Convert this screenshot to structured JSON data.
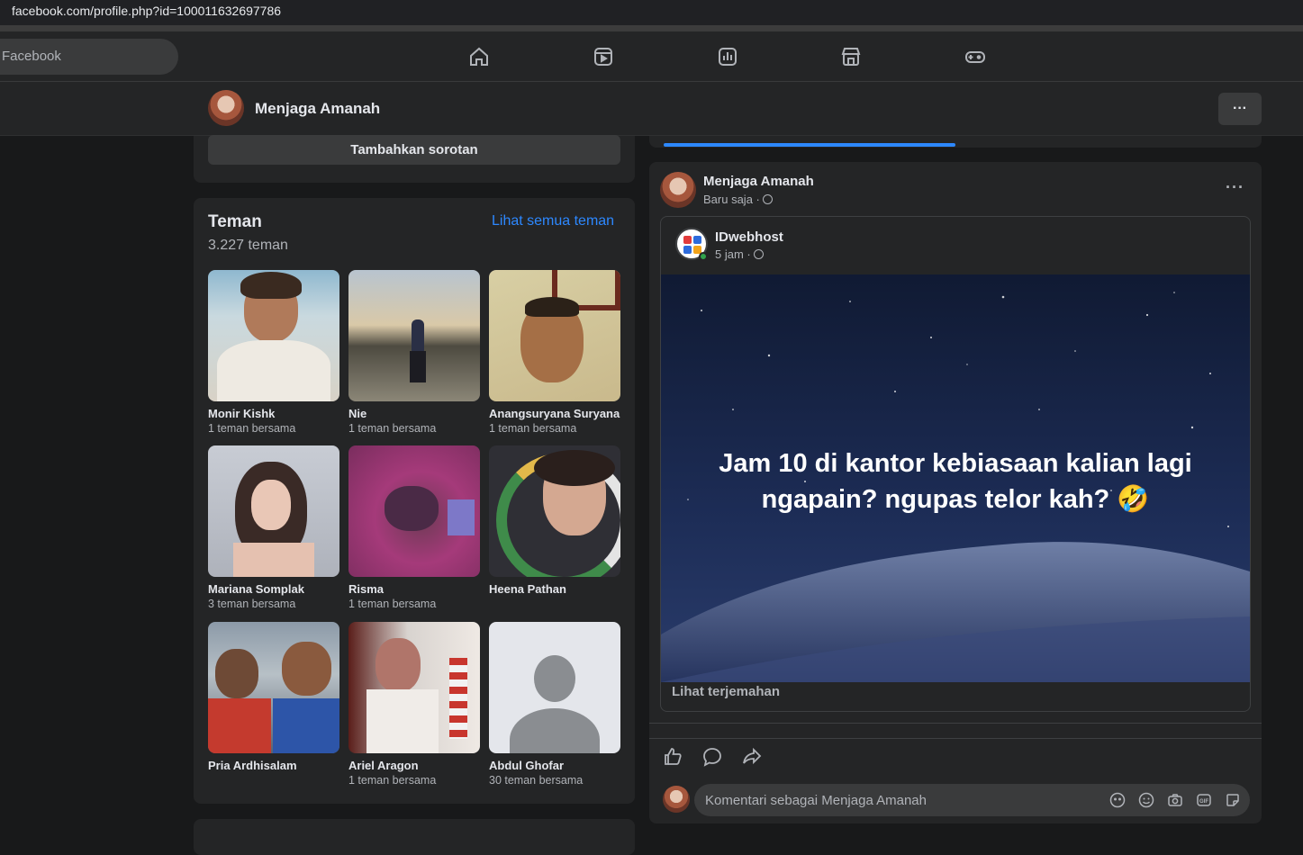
{
  "browser": {
    "url": "facebook.com/profile.php?id=100011632697786"
  },
  "topnav": {
    "search_placeholder": "Facebook",
    "icons": [
      "home-icon",
      "video-icon",
      "feed-chart-icon",
      "marketplace-icon",
      "gaming-icon"
    ]
  },
  "profile_bar": {
    "name": "Menjaga Amanah",
    "more_label": "···"
  },
  "highlights": {
    "add_label": "Tambahkan sorotan"
  },
  "friends": {
    "title": "Teman",
    "count": "3.227 teman",
    "see_all": "Lihat semua teman",
    "items": [
      {
        "name": "Monir Kishk",
        "mutual": "1 teman bersama"
      },
      {
        "name": "Nie",
        "mutual": "1 teman bersama"
      },
      {
        "name": "Anangsuryana Suryana",
        "mutual": "1 teman bersama"
      },
      {
        "name": "Mariana Somplak",
        "mutual": "3 teman bersama"
      },
      {
        "name": "Risma",
        "mutual": "1 teman bersama"
      },
      {
        "name": "Heena Pathan",
        "mutual": ""
      },
      {
        "name": "Pria Ardhisalam",
        "mutual": ""
      },
      {
        "name": "Ariel Aragon",
        "mutual": "1 teman bersama"
      },
      {
        "name": "Abdul Ghofar",
        "mutual": "30 teman bersama"
      }
    ]
  },
  "post": {
    "author": "Menjaga Amanah",
    "time": "Baru saja ·",
    "shared": {
      "author": "IDwebhost",
      "time": "5 jam ·",
      "image_text": "Jam 10 di kantor kebiasaan kalian lagi ngapain? ngupas telor kah? 🤣",
      "translate": "Lihat terjemahan"
    },
    "comment_placeholder": "Komentari sebagai Menjaga Amanah"
  }
}
